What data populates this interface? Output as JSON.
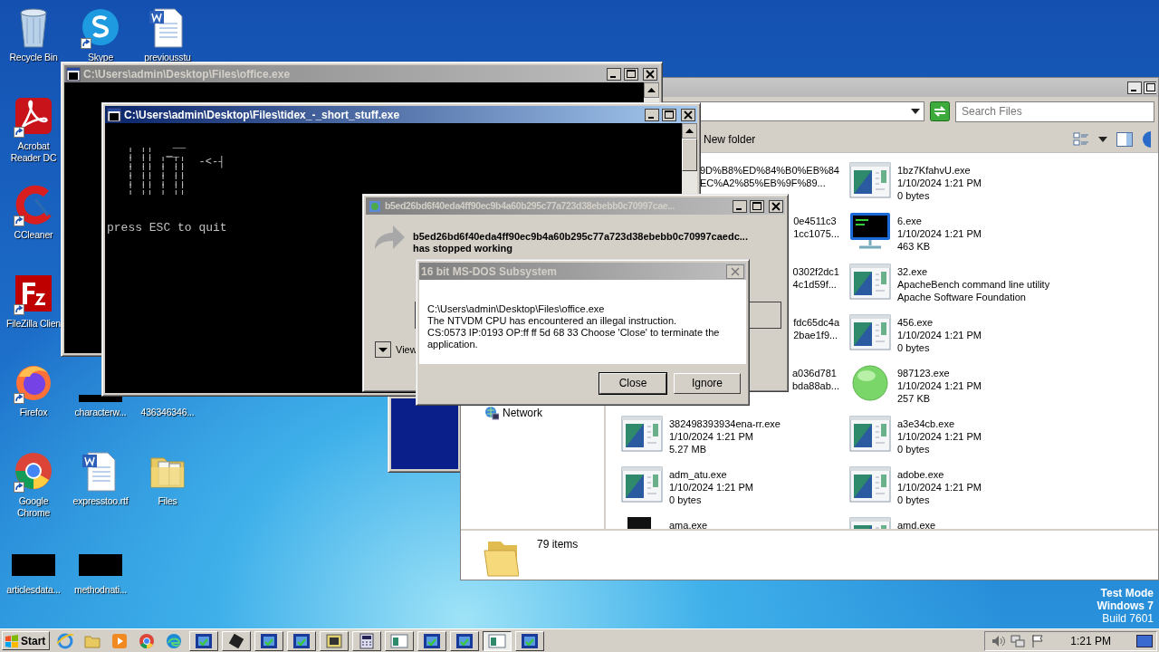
{
  "desktop": {
    "icons": [
      {
        "label": "Recycle Bin",
        "kind": "recycle",
        "shortcut": false
      },
      {
        "label": "Skype",
        "kind": "skype",
        "shortcut": true
      },
      {
        "label": "previousstu",
        "kind": "word",
        "shortcut": false
      },
      {
        "label": "Acrobat Reader DC",
        "kind": "acrobat",
        "shortcut": true
      },
      {
        "label": "CCleaner",
        "kind": "ccleaner",
        "shortcut": true
      },
      {
        "label": "FileZilla Clien",
        "kind": "filezilla",
        "shortcut": true
      },
      {
        "label": "Firefox",
        "kind": "firefox",
        "shortcut": true
      },
      {
        "label": "characterw...",
        "kind": "strip",
        "shortcut": false
      },
      {
        "label": "436346346...",
        "kind": "hidden",
        "shortcut": false
      },
      {
        "label": "Google Chrome",
        "kind": "chrome",
        "shortcut": true
      },
      {
        "label": "expresstoo.rtf",
        "kind": "word",
        "shortcut": false
      },
      {
        "label": "Files",
        "kind": "folder",
        "shortcut": false
      },
      {
        "label": "articlesdata...",
        "kind": "black",
        "shortcut": false
      },
      {
        "label": "methodnati...",
        "kind": "black",
        "shortcut": false
      }
    ]
  },
  "explorer": {
    "search": {
      "placeholder": "Search Files"
    },
    "command": "New folder",
    "nav_items": [
      "Network"
    ],
    "files": [
      {
        "kind": "partial",
        "lines": [
          "9D%B8%ED%84%B0%EB%84",
          "EC%A2%85%EB%9F%89..."
        ]
      },
      {
        "kind": "app",
        "lines": [
          "1bz7KfahvU.exe",
          "1/10/2024 1:21 PM",
          "0 bytes"
        ]
      },
      {
        "kind": "partial",
        "lines": [
          "0e4511c3",
          "1cc1075..."
        ]
      },
      {
        "kind": "console",
        "lines": [
          "6.exe",
          "1/10/2024 1:21 PM",
          "463 KB"
        ]
      },
      {
        "kind": "partial",
        "lines": [
          "0302f2dc1",
          "4c1d59f..."
        ]
      },
      {
        "kind": "app",
        "lines": [
          "32.exe",
          "ApacheBench command line utility",
          "Apache Software Foundation"
        ]
      },
      {
        "kind": "partial",
        "lines": [
          "fdc65dc4a",
          "2bae1f9..."
        ]
      },
      {
        "kind": "app",
        "lines": [
          "456.exe",
          "1/10/2024 1:21 PM",
          "0 bytes"
        ]
      },
      {
        "kind": "partial",
        "lines": [
          "a036d781",
          "bda88ab..."
        ]
      },
      {
        "kind": "orb",
        "lines": [
          "987123.exe",
          "1/10/2024 1:21 PM",
          "257 KB"
        ]
      },
      {
        "kind": "app",
        "lines": [
          "382498393934ena-rr.exe",
          "1/10/2024 1:21 PM",
          "5.27 MB"
        ]
      },
      {
        "kind": "app",
        "lines": [
          "a3e34cb.exe",
          "1/10/2024 1:21 PM",
          "0 bytes"
        ]
      },
      {
        "kind": "app",
        "lines": [
          "adm_atu.exe",
          "1/10/2024 1:21 PM",
          "0 bytes"
        ]
      },
      {
        "kind": "app",
        "lines": [
          "adobe.exe",
          "1/10/2024 1:21 PM",
          "0 bytes"
        ]
      },
      {
        "kind": "dark",
        "lines": [
          "ama.exe"
        ]
      },
      {
        "kind": "app",
        "lines": [
          "amd.exe"
        ]
      }
    ],
    "status": "79 items"
  },
  "office_console": {
    "title": "C:\\Users\\admin\\Desktop\\Files\\office.exe",
    "active": false
  },
  "tidex_console": {
    "title": "C:\\Users\\admin\\Desktop\\Files\\tidex_-_short_stuff.exe",
    "active": true,
    "art": [
      "         __",
      "  ¦ ¦¦  __",
      "  ¦ ¦¦ ¦‾¦¦  -<-┤",
      "  ¦ ¦¦ ¦ ¦¦",
      "  ¦ ¦¦ ¦ ¦¦",
      "  ¦ ¦¦ ¦ ¦¦"
    ],
    "prompt": "press ESC to quit"
  },
  "error_report": {
    "title": "b5ed26bd6f40eda4ff90ec9b4a60b295c77a723d38ebebb0c70997cae...",
    "active": false,
    "heading": "b5ed26bd6f40eda4ff90ec9b4a60b295c77a723d38ebebb0c70997caedc...",
    "subheading": "has stopped working",
    "details_label": "View"
  },
  "ntvdm_dialog": {
    "title": "16 bit MS-DOS Subsystem",
    "message": [
      "C:\\Users\\admin\\Desktop\\Files\\office.exe",
      "The NTVDM CPU has encountered an illegal instruction.",
      "CS:0573 IP:0193 OP:ff ff 5d 68 33 Choose 'Close' to terminate the application."
    ],
    "buttons": [
      {
        "label": "Close",
        "default": true
      },
      {
        "label": "Ignore",
        "default": false
      }
    ]
  },
  "os_notice": [
    {
      "text": "Test Mode",
      "bold": true
    },
    {
      "text": "Windows 7",
      "bold": true
    },
    {
      "text": "Build 7601",
      "bold": false
    }
  ],
  "taskbar": {
    "start": "Start",
    "quick_launch": [
      {
        "kind": "ie"
      },
      {
        "kind": "folder"
      },
      {
        "kind": "media"
      },
      {
        "kind": "chrome"
      },
      {
        "kind": "edge"
      }
    ],
    "tasks": [
      {
        "kind": "cmd",
        "selected": false
      },
      {
        "kind": "chip",
        "selected": false
      },
      {
        "kind": "cmd",
        "selected": false
      },
      {
        "kind": "cmd",
        "selected": false
      },
      {
        "kind": "setup",
        "selected": false
      },
      {
        "kind": "calc",
        "selected": false
      },
      {
        "kind": "window",
        "selected": false
      },
      {
        "kind": "cmd",
        "selected": false
      },
      {
        "kind": "cmd",
        "selected": false
      },
      {
        "kind": "window",
        "selected": true
      },
      {
        "kind": "cmd",
        "selected": false
      }
    ],
    "clock": "1:21 PM"
  }
}
